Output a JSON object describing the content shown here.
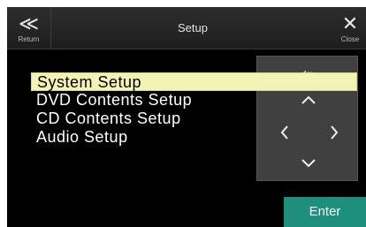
{
  "header": {
    "title": "Setup",
    "return_label": "Return",
    "close_label": "Close",
    "return_icon": "double-chevron-left-icon",
    "close_icon": "close-x-icon"
  },
  "menu": {
    "items": [
      {
        "label": "System Setup",
        "selected": true
      },
      {
        "label": "DVD Contents Setup",
        "selected": false
      },
      {
        "label": "CD Contents Setup",
        "selected": false
      },
      {
        "label": "Audio Setup",
        "selected": false
      }
    ]
  },
  "pad": {
    "back_icon": "arrow-left-icon",
    "up_icon": "chevron-up-icon",
    "left_icon": "chevron-left-icon",
    "right_icon": "chevron-right-icon",
    "down_icon": "chevron-down-icon"
  },
  "enter_label": "Enter",
  "colors": {
    "background": "#000000",
    "header": "#2a2a2a",
    "selection": "#f4f3b6",
    "pad": "#404040",
    "enter": "#1f8f7d"
  }
}
